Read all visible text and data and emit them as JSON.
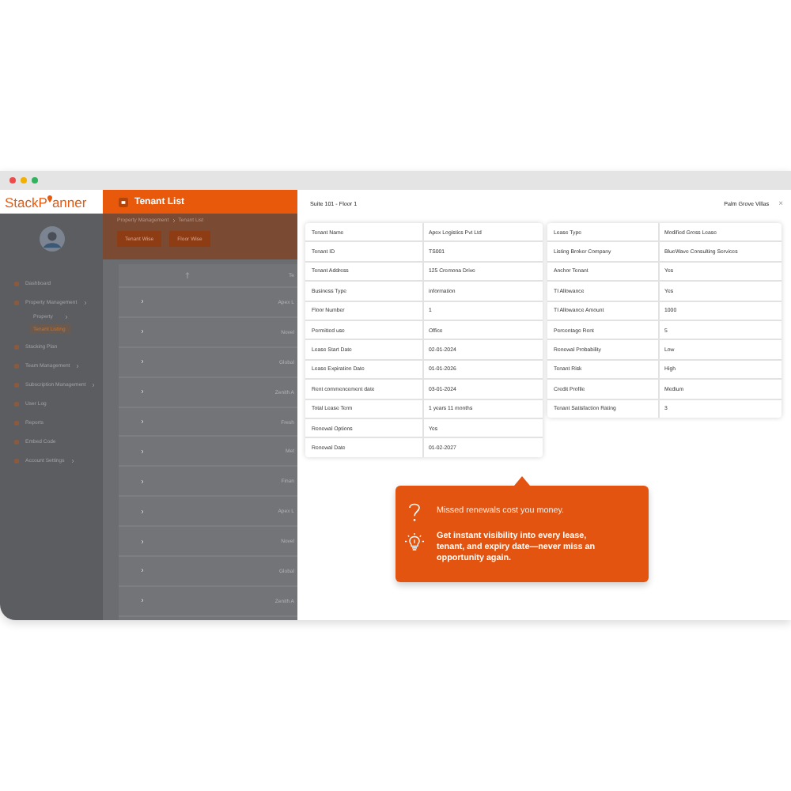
{
  "app": {
    "logo_parts": [
      "StackP",
      "anner"
    ],
    "header_title": "Tenant List"
  },
  "sidebar": {
    "items": [
      {
        "label": "Dashboard",
        "expandable": false,
        "selected": false
      },
      {
        "label": "Property Management",
        "expandable": true,
        "selected": false,
        "children": [
          {
            "label": "Property",
            "expandable": true,
            "selected": false
          },
          {
            "label": "Tenant Listing",
            "expandable": false,
            "selected": true
          }
        ]
      },
      {
        "label": "Stacking Plan",
        "expandable": false,
        "selected": false
      },
      {
        "label": "Team Management",
        "expandable": true,
        "selected": false
      },
      {
        "label": "Subscription Management",
        "expandable": true,
        "selected": false
      },
      {
        "label": "User Log",
        "expandable": false,
        "selected": false
      },
      {
        "label": "Reports",
        "expandable": false,
        "selected": false
      },
      {
        "label": "Embed Code",
        "expandable": false,
        "selected": false
      },
      {
        "label": "Account Settings",
        "expandable": true,
        "selected": false
      }
    ]
  },
  "breadcrumb": [
    "Property Management",
    "Tenant List"
  ],
  "view_buttons": [
    "Tenant Wise",
    "Floor Wise"
  ],
  "table": {
    "column_2": "Te",
    "rows": [
      "Apex L",
      "Novel",
      "Global",
      "Zenith A",
      "Fresh",
      "Met",
      "Finan",
      "Apex L",
      "Novel",
      "Global",
      "Zenith A"
    ]
  },
  "modal": {
    "title": "Suite 101 - Floor 1",
    "property": "Palm Grove Villas",
    "close": "×",
    "left_table": [
      {
        "label": "Tenant Name",
        "value": "Apex Logistics Pvt Ltd"
      },
      {
        "label": "Tenant ID",
        "value": "TS001"
      },
      {
        "label": "Tenant Address",
        "value": "125 Cremona Drive"
      },
      {
        "label": "Business Type",
        "value": "information"
      },
      {
        "label": "Floor Number",
        "value": "1"
      },
      {
        "label": "Permitted use",
        "value": "Office"
      },
      {
        "label": "Lease Start Date",
        "value": "02-01-2024"
      },
      {
        "label": "Lease Expiration Date",
        "value": "01-01-2026"
      },
      {
        "label": "Rent commencement date",
        "value": "03-01-2024"
      },
      {
        "label": "Total Lease Term",
        "value": "1 years 11 months"
      },
      {
        "label": "Renewal Options",
        "value": "Yes"
      },
      {
        "label": "Renewal Date",
        "value": "01-02-2027"
      }
    ],
    "right_table": [
      {
        "label": "Lease Type",
        "value": "Modified Gross Lease"
      },
      {
        "label": "Listing Broker Company",
        "value": "BlueWave Consulting Services"
      },
      {
        "label": "Anchor Tenant",
        "value": "Yes"
      },
      {
        "label": "TI Allowance",
        "value": "Yes"
      },
      {
        "label": "TI Allowance Amount",
        "value": "1000"
      },
      {
        "label": "Percentage Rent",
        "value": "5"
      },
      {
        "label": "Renewal Probability",
        "value": "Low"
      },
      {
        "label": "Tenant Risk",
        "value": "High"
      },
      {
        "label": "Credit Profile",
        "value": "Medium"
      },
      {
        "label": "Tenant Satisfaction Rating",
        "value": "3"
      }
    ]
  },
  "callout": {
    "items": [
      {
        "kind": "question",
        "text": "Missed renewals cost you money."
      },
      {
        "kind": "idea",
        "text": "Get instant visibility into every lease, tenant, and expiry date—never miss an opportunity again."
      }
    ]
  }
}
